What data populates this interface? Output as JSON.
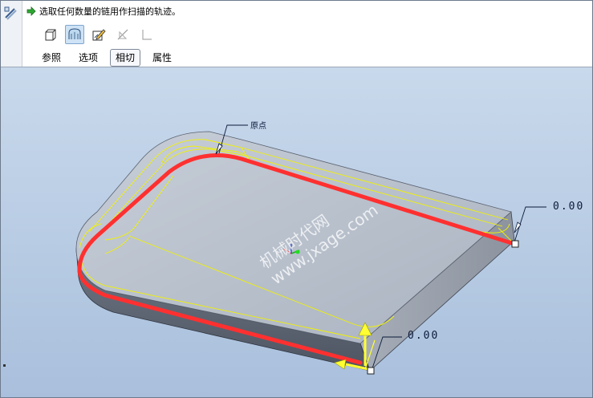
{
  "dashboard": {
    "prompt_text": "选取任何数量的链用作扫描的轨迹。",
    "toolbar": [
      {
        "icon": "solid-icon",
        "active": false
      },
      {
        "icon": "surface-icon",
        "active": true
      },
      {
        "icon": "edit-sketch-icon",
        "active": false
      },
      {
        "icon": "remove-material-icon",
        "active": false
      },
      {
        "icon": "thicken-icon",
        "active": false
      }
    ],
    "tabs": [
      {
        "label": "参照",
        "active": false
      },
      {
        "label": "选项",
        "active": false
      },
      {
        "label": "相切",
        "active": true
      },
      {
        "label": "属性",
        "active": false
      }
    ]
  },
  "viewport": {
    "start_point_label": "原点",
    "dimension_right": "0.00",
    "dimension_front": "0.00",
    "watermark_line1": "机械时代网",
    "watermark_line2": "www.jxage.com",
    "colors": {
      "trajectory": "#ff3030",
      "edges": "#f2f200",
      "arrow": "#ffff33",
      "background_top": "#c9d9ec",
      "background_bottom": "#a9bfdc"
    }
  }
}
